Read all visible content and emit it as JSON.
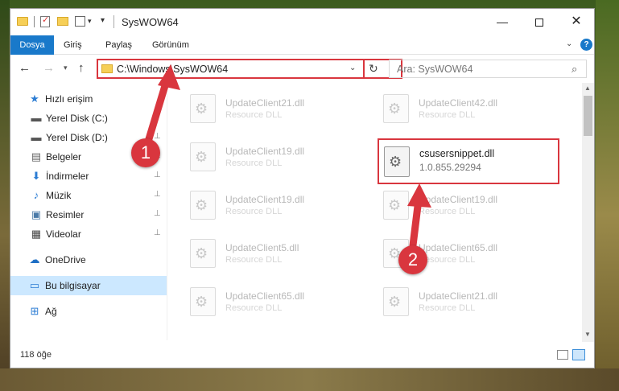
{
  "window": {
    "title": "SysWOW64",
    "min_label": "—",
    "close_label": "✕"
  },
  "quick_access": {
    "dropdown_glyph": "▾",
    "customize_glyph": "▾"
  },
  "ribbon": {
    "tabs": [
      {
        "label": "Dosya",
        "active": true
      },
      {
        "label": "Giriş"
      },
      {
        "label": "Paylaş"
      },
      {
        "label": "Görünüm"
      }
    ],
    "expand_glyph": "⌄",
    "help_label": "?"
  },
  "nav": {
    "back_glyph": "←",
    "forward_glyph": "→",
    "recent_glyph": "▾",
    "up_glyph": "↑"
  },
  "address": {
    "path": "C:\\Windows\\SysWOW64",
    "dropdown_glyph": "⌄",
    "refresh_glyph": "↻"
  },
  "search": {
    "placeholder": "Ara: SysWOW64",
    "icon_glyph": "⌕"
  },
  "sidebar": {
    "items": [
      {
        "label": "Hızlı erişim",
        "icon": "star-icon",
        "glyph": "★",
        "color": "#2b7cd3"
      },
      {
        "label": "Yerel Disk (C:)",
        "icon": "drive-icon",
        "glyph": "▬",
        "color": "#555"
      },
      {
        "label": "Yerel Disk (D:)",
        "icon": "drive-icon",
        "glyph": "▬",
        "color": "#555",
        "pinned": true
      },
      {
        "label": "Belgeler",
        "icon": "documents-icon",
        "glyph": "▤",
        "color": "#666",
        "pinned": true
      },
      {
        "label": "İndirmeler",
        "icon": "download-icon",
        "glyph": "⬇",
        "color": "#2b7cd3",
        "pinned": true
      },
      {
        "label": "Müzik",
        "icon": "music-icon",
        "glyph": "♪",
        "color": "#2b7cd3",
        "pinned": true
      },
      {
        "label": "Resimler",
        "icon": "pictures-icon",
        "glyph": "▣",
        "color": "#4a7aa8",
        "pinned": true
      },
      {
        "label": "Videolar",
        "icon": "videos-icon",
        "glyph": "▦",
        "color": "#444",
        "pinned": true
      },
      {
        "label": "OneDrive",
        "icon": "cloud-icon",
        "glyph": "☁",
        "color": "#1f6fc5"
      },
      {
        "label": "Bu bilgisayar",
        "icon": "computer-icon",
        "glyph": "▭",
        "color": "#2b7cd3",
        "selected": true
      },
      {
        "label": "Ağ",
        "icon": "network-icon",
        "glyph": "⊞",
        "color": "#2b7cd3"
      }
    ],
    "pin_glyph": "📌"
  },
  "files": [
    {
      "name": "UpdateClient21.dll",
      "desc": "Resource DLL"
    },
    {
      "name": "UpdateClient42.dll",
      "desc": "Resource DLL"
    },
    {
      "name": "UpdateClient19.dll",
      "desc": "Resource DLL"
    },
    {
      "name": "UpdateClient19.dll",
      "desc": "Resource DLL"
    },
    {
      "name": "UpdateClient19.dll",
      "desc": "Resource DLL"
    },
    {
      "name": "UpdateClient5.dll",
      "desc": "Resource DLL"
    },
    {
      "name": "UpdateClient65.dll",
      "desc": "Resource DLL"
    },
    {
      "name": "UpdateClient65.dll",
      "desc": "Resource DLL"
    },
    {
      "name": "UpdateClient21.dll",
      "desc": "Resource DLL"
    }
  ],
  "highlighted_file": {
    "name": "csusersnippet.dll",
    "version": "1.0.855.29294"
  },
  "status": {
    "item_count": "118 öğe"
  },
  "callouts": [
    "1",
    "2"
  ],
  "colors": {
    "accent": "#1979ca",
    "highlight_red": "#d9363e",
    "selection": "#cce8ff"
  }
}
